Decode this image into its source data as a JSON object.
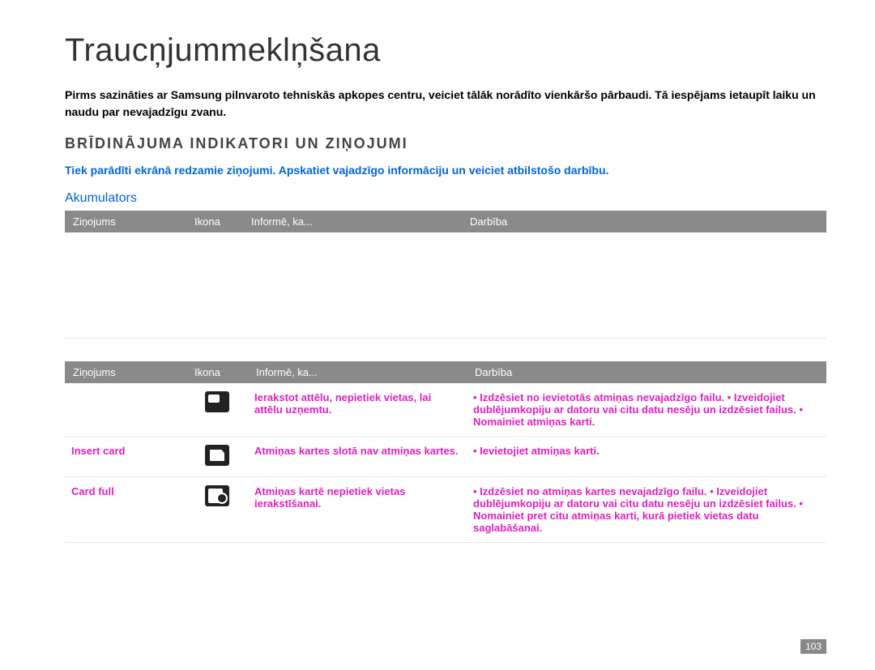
{
  "title": "Traucņjummeklņšana",
  "intro": "Pirms sazināties ar Samsung pilnvaroto tehniskās apkopes centru, veiciet tālāk norādīto vienkāršo pārbaudi. Tā iespējams ietaupīt laiku un naudu par nevajadzīgu zvanu.",
  "section_heading": "BRĪDINĀJUMA INDIKATORI UN ZIŅOJUMI",
  "note": "Tiek parādīti ekrānā redzamie ziņojumi. Apskatiet vajadzīgo informāciju un veiciet atbilstošo darbību.",
  "table_headers": {
    "col1": "Ziņojums",
    "col2": "Ikona",
    "col3": "Informē, ka...",
    "col4": "Darbība"
  },
  "subsection1": "Akumulators",
  "subsection2_rows": [
    {
      "icon": "sd",
      "info": "Ierakstot attēlu, nepietiek vietas, lai attēlu uzņemtu.",
      "action": "• Izdzēsiet no ievietotās atmiņas nevajadzīgo failu. • Izveidojiet dublējumkopiju ar datoru vai citu datu nesēju un izdzēsiet failus. • Nomainiet atmiņas karti."
    },
    {
      "msg": "Insert card",
      "icon": "insert",
      "info": "Atmiņas kartes slotā nav atmiņas kartes.",
      "action": "• Ievietojiet atmiņas karti."
    },
    {
      "msg": "Card full",
      "icon": "full",
      "info": "Atmiņas kartē nepietiek vietas ierakstīšanai.",
      "action": "• Izdzēsiet no atmiņas kartes nevajadzīgo failu. • Izveidojiet dublējumkopiju ar datoru vai citu datu nesēju un izdzēsiet failus. • Nomainiet pret citu atmiņas karti, kurā pietiek vietas datu saglabāšanai."
    }
  ],
  "page_number": "103"
}
